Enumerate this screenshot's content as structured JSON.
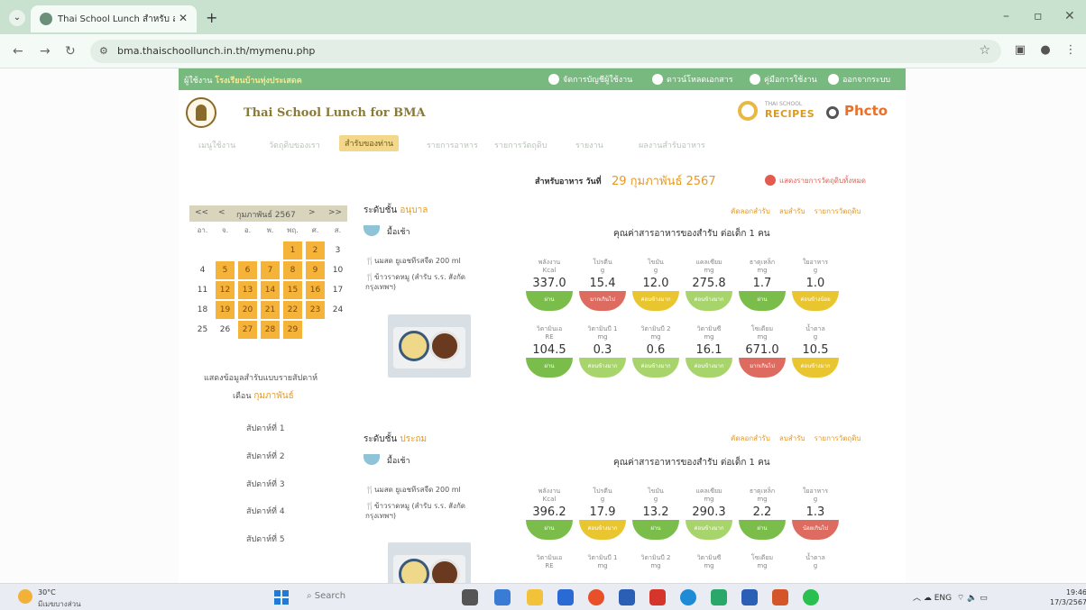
{
  "browser": {
    "tab_title": "Thai School Lunch สำหรับ สำนัก",
    "url": "bma.thaischoollunch.in.th/mymenu.php"
  },
  "topbar": {
    "user_prefix": "ผู้ใช้งาน",
    "user_name": "โรงเรียนบ้านทุ่งประเสดค",
    "links": [
      "จัดการบัญชีผู้ใช้งาน",
      "ดาวน์โหลดเอกสาร",
      "คู่มือการใช้งาน",
      "ออกจากระบบ"
    ]
  },
  "header": {
    "site_title": "Thai School Lunch for BMA",
    "recipes_small": "THAI SCHOOL",
    "recipes_big": "RECIPES",
    "photo_logo": "Phcto"
  },
  "menu": [
    "เมนูใช้งาน",
    "วัตถุดิบของเรา",
    "สำรับของท่าน",
    "รายการอาหาร",
    "รายการวัตถุดิบ",
    "รายงาน",
    "ผลงานสำรับอาหาร"
  ],
  "meal_header": {
    "label": "สำหรับอาหาร วันที่",
    "date": "29 กุมภาพันธ์ 2567",
    "show_link": "แสดงรายการวัตถุดิบทั้งหมด"
  },
  "calendar": {
    "prev2": "<<",
    "prev": "<",
    "month": "กุมภาพันธ์ 2567",
    "next": ">",
    "next2": ">>",
    "days": [
      "อา.",
      "จ.",
      "อ.",
      "พ.",
      "พฤ.",
      "ศ.",
      "ส."
    ],
    "weeks": [
      [
        {
          "d": "",
          "m": false
        },
        {
          "d": "",
          "m": false
        },
        {
          "d": "",
          "m": false
        },
        {
          "d": "",
          "m": false
        },
        {
          "d": "1",
          "m": true
        },
        {
          "d": "2",
          "m": true
        },
        {
          "d": "3",
          "m": false
        }
      ],
      [
        {
          "d": "4",
          "m": false
        },
        {
          "d": "5",
          "m": true
        },
        {
          "d": "6",
          "m": true
        },
        {
          "d": "7",
          "m": true
        },
        {
          "d": "8",
          "m": true
        },
        {
          "d": "9",
          "m": true
        },
        {
          "d": "10",
          "m": false
        }
      ],
      [
        {
          "d": "11",
          "m": false
        },
        {
          "d": "12",
          "m": true
        },
        {
          "d": "13",
          "m": true
        },
        {
          "d": "14",
          "m": true
        },
        {
          "d": "15",
          "m": true
        },
        {
          "d": "16",
          "m": true
        },
        {
          "d": "17",
          "m": false
        }
      ],
      [
        {
          "d": "18",
          "m": false
        },
        {
          "d": "19",
          "m": true
        },
        {
          "d": "20",
          "m": true
        },
        {
          "d": "21",
          "m": true
        },
        {
          "d": "22",
          "m": true
        },
        {
          "d": "23",
          "m": true
        },
        {
          "d": "24",
          "m": false
        }
      ],
      [
        {
          "d": "25",
          "m": false
        },
        {
          "d": "26",
          "m": false
        },
        {
          "d": "27",
          "m": true
        },
        {
          "d": "28",
          "m": true
        },
        {
          "d": "29",
          "m": true
        },
        {
          "d": "",
          "m": false
        },
        {
          "d": "",
          "m": false
        }
      ]
    ],
    "weekly_label": "แสดงข้อมูลสำรับแบบรายสัปดาห์",
    "month_label": "เดือน",
    "month_value": "กุมภาพันธ์",
    "weeks_list": [
      "สัปดาห์ที่ 1",
      "สัปดาห์ที่ 2",
      "สัปดาห์ที่ 3",
      "สัปดาห์ที่ 4",
      "สัปดาห์ที่ 5"
    ]
  },
  "sections": [
    {
      "level_prefix": "ระดับชั้น",
      "level": "อนุบาล",
      "meal": "มื้อเช้า",
      "dishes": [
        "นมสด ยูเอชทีรสจืด 200 ml",
        "ข้าวราดหมู (สำรับ ร.ร. สังกัด กรุงเทพฯ)"
      ],
      "links": [
        "คัดลอกสำรับ",
        "ลบสำรับ",
        "รายการวัตถุดิบ"
      ],
      "nutrition_title": "คุณค่าสารอาหารของสำรับ ต่อเด็ก 1 คน",
      "nutrients": [
        {
          "name": "พลังงาน",
          "unit": "Kcal",
          "value": "337.0",
          "status": "ผ่าน",
          "color": "g"
        },
        {
          "name": "โปรตีน",
          "unit": "g",
          "value": "15.4",
          "status": "มากเกินไป",
          "color": "r"
        },
        {
          "name": "ไขมัน",
          "unit": "g",
          "value": "12.0",
          "status": "ค่อนข้างมาก",
          "color": "y"
        },
        {
          "name": "แคลเซียม",
          "unit": "mg",
          "value": "275.8",
          "status": "ค่อนข้างมาก",
          "color": "lg"
        },
        {
          "name": "ธาตุเหล็ก",
          "unit": "mg",
          "value": "1.7",
          "status": "ผ่าน",
          "color": "g"
        },
        {
          "name": "ใยอาหาร",
          "unit": "g",
          "value": "1.0",
          "status": "ค่อนข้างน้อย",
          "color": "y"
        },
        {
          "name": "วิตามินเอ",
          "unit": "RE",
          "value": "104.5",
          "status": "ผ่าน",
          "color": "g"
        },
        {
          "name": "วิตามินบี 1",
          "unit": "mg",
          "value": "0.3",
          "status": "ค่อนข้างมาก",
          "color": "lg"
        },
        {
          "name": "วิตามินบี 2",
          "unit": "mg",
          "value": "0.6",
          "status": "ค่อนข้างมาก",
          "color": "lg"
        },
        {
          "name": "วิตามินซี",
          "unit": "mg",
          "value": "16.1",
          "status": "ค่อนข้างมาก",
          "color": "lg"
        },
        {
          "name": "โซเดียม",
          "unit": "mg",
          "value": "671.0",
          "status": "มากเกินไป",
          "color": "r"
        },
        {
          "name": "น้ำตาล",
          "unit": "g",
          "value": "10.5",
          "status": "ค่อนข้างมาก",
          "color": "y"
        }
      ]
    },
    {
      "level_prefix": "ระดับชั้น",
      "level": "ประถม",
      "meal": "มื้อเช้า",
      "dishes": [
        "นมสด ยูเอชทีรสจืด 200 ml",
        "ข้าวราดหมู (สำรับ ร.ร. สังกัด กรุงเทพฯ)"
      ],
      "links": [
        "คัดลอกสำรับ",
        "ลบสำรับ",
        "รายการวัตถุดิบ"
      ],
      "nutrition_title": "คุณค่าสารอาหารของสำรับ ต่อเด็ก 1 คน",
      "nutrients": [
        {
          "name": "พลังงาน",
          "unit": "Kcal",
          "value": "396.2",
          "status": "ผ่าน",
          "color": "g"
        },
        {
          "name": "โปรตีน",
          "unit": "g",
          "value": "17.9",
          "status": "ค่อนข้างมาก",
          "color": "y"
        },
        {
          "name": "ไขมัน",
          "unit": "g",
          "value": "13.2",
          "status": "ผ่าน",
          "color": "g"
        },
        {
          "name": "แคลเซียม",
          "unit": "mg",
          "value": "290.3",
          "status": "ค่อนข้างมาก",
          "color": "lg"
        },
        {
          "name": "ธาตุเหล็ก",
          "unit": "mg",
          "value": "2.2",
          "status": "ผ่าน",
          "color": "g"
        },
        {
          "name": "ใยอาหาร",
          "unit": "g",
          "value": "1.3",
          "status": "น้อยเกินไป",
          "color": "r"
        },
        {
          "name": "วิตามินเอ",
          "unit": "RE",
          "value": "",
          "status": "",
          "color": "g"
        },
        {
          "name": "วิตามินบี 1",
          "unit": "mg",
          "value": "",
          "status": "",
          "color": "g"
        },
        {
          "name": "วิตามินบี 2",
          "unit": "mg",
          "value": "",
          "status": "",
          "color": "g"
        },
        {
          "name": "วิตามินซี",
          "unit": "mg",
          "value": "",
          "status": "",
          "color": "g"
        },
        {
          "name": "โซเดียม",
          "unit": "mg",
          "value": "",
          "status": "",
          "color": "g"
        },
        {
          "name": "น้ำตาล",
          "unit": "g",
          "value": "",
          "status": "",
          "color": "g"
        }
      ]
    }
  ],
  "taskbar": {
    "temp": "30°C",
    "weather": "มีเมฆบางส่วน",
    "search": "Search",
    "lang": "ENG",
    "time": "19:46",
    "date": "17/3/2567"
  }
}
